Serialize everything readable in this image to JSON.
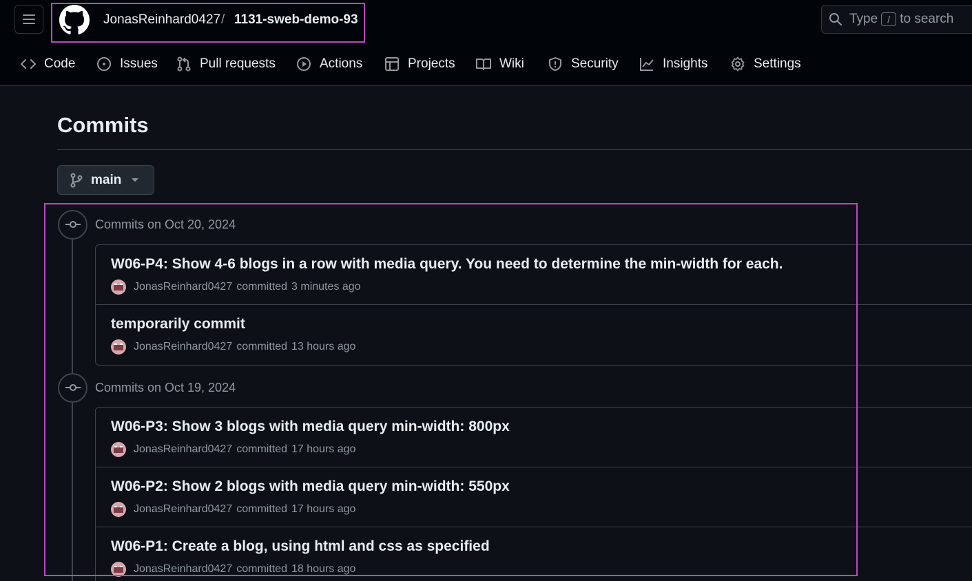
{
  "header": {
    "owner": "JonasReinhard0427",
    "separator": "/",
    "repo": "1131-sweb-demo-93",
    "search": {
      "prefix": "Type",
      "key": "/",
      "suffix": "to search"
    }
  },
  "nav": [
    {
      "label": "Code",
      "icon": "code-icon"
    },
    {
      "label": "Issues",
      "icon": "issue-icon"
    },
    {
      "label": "Pull requests",
      "icon": "pull-request-icon"
    },
    {
      "label": "Actions",
      "icon": "play-icon"
    },
    {
      "label": "Projects",
      "icon": "table-icon"
    },
    {
      "label": "Wiki",
      "icon": "book-icon"
    },
    {
      "label": "Security",
      "icon": "shield-icon"
    },
    {
      "label": "Insights",
      "icon": "graph-icon"
    },
    {
      "label": "Settings",
      "icon": "gear-icon"
    }
  ],
  "page": {
    "title": "Commits"
  },
  "branch": {
    "name": "main"
  },
  "groups": [
    {
      "label": "Commits on Oct 20, 2024",
      "commits": [
        {
          "title": "W06-P4: Show 4-6 blogs in a row with media query. You need to determine the min-width for each.",
          "author": "JonasReinhard0427",
          "verb": "committed",
          "time": "3 minutes ago"
        },
        {
          "title": "temporarily commit",
          "author": "JonasReinhard0427",
          "verb": "committed",
          "time": "13 hours ago"
        }
      ]
    },
    {
      "label": "Commits on Oct 19, 2024",
      "commits": [
        {
          "title": "W06-P3: Show 3 blogs with media query min-width: 800px",
          "author": "JonasReinhard0427",
          "verb": "committed",
          "time": "17 hours ago"
        },
        {
          "title": "W06-P2: Show 2 blogs with media query min-width: 550px",
          "author": "JonasReinhard0427",
          "verb": "committed",
          "time": "17 hours ago"
        },
        {
          "title": "W06-P1: Create a blog, using html and css as specified",
          "author": "JonasReinhard0427",
          "verb": "committed",
          "time": "18 hours ago"
        }
      ]
    }
  ],
  "colors": {
    "background": "#0d1117",
    "header": "#010409",
    "border": "#3d444d",
    "highlight": "#c043c7",
    "muted": "#9198a1"
  }
}
